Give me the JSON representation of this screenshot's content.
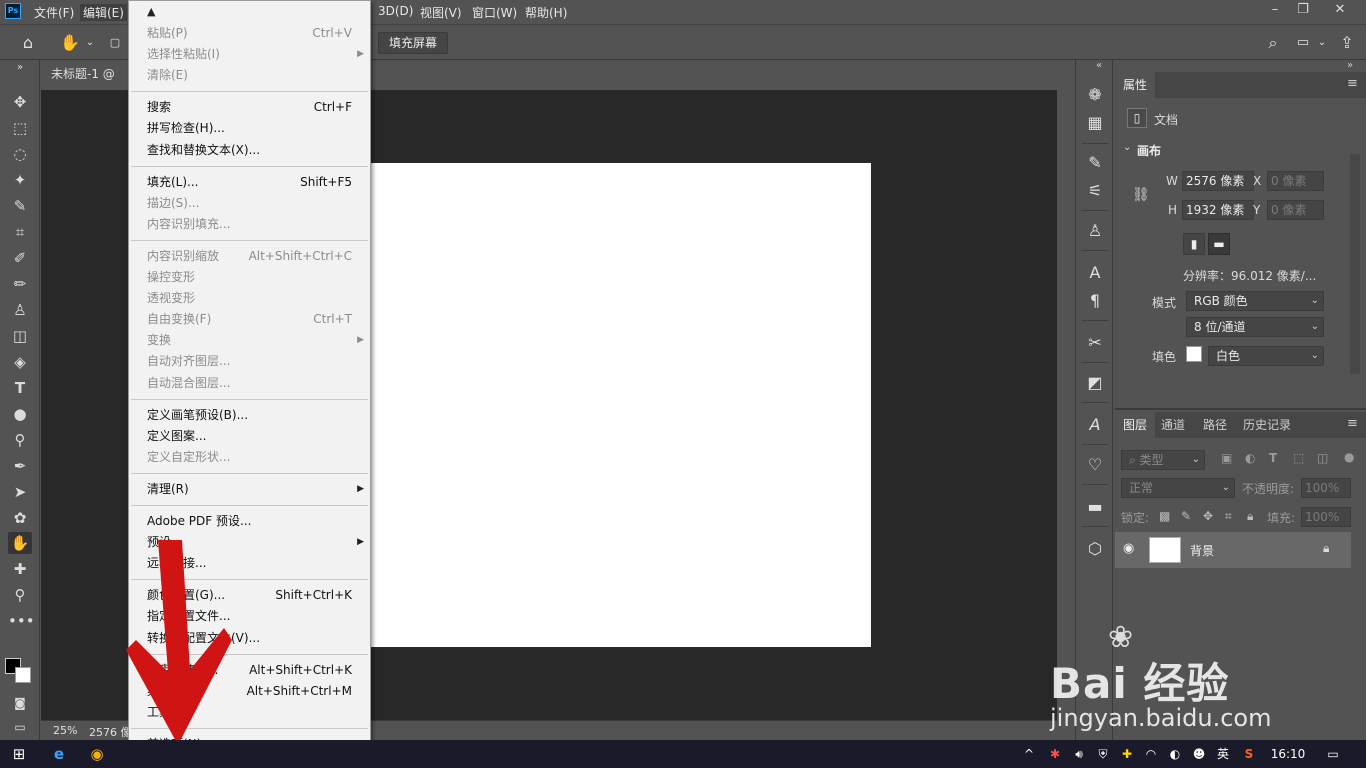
{
  "menubar": {
    "logo": "Ps",
    "items": [
      "文件(F)",
      "编辑(E)",
      "3D(D)",
      "视图(V)",
      "窗口(W)",
      "帮助(H)"
    ],
    "window_controls": [
      "–",
      "❐",
      "✕"
    ]
  },
  "options_bar": {
    "fill_screen": "填充屏幕"
  },
  "document": {
    "tab_title": "未标题-1 @ 25",
    "zoom": "25%",
    "doc_size": "2576 像"
  },
  "edit_menu": {
    "top_arrow": "▲",
    "bottom_arrow": "▼",
    "groups": [
      [
        {
          "label": "粘贴(P)",
          "shortcut": "Ctrl+V",
          "disabled": true,
          "submenu": false
        },
        {
          "label": "选择性粘贴(I)",
          "shortcut": "",
          "disabled": true,
          "submenu": true
        },
        {
          "label": "清除(E)",
          "shortcut": "",
          "disabled": true,
          "submenu": false
        }
      ],
      [
        {
          "label": "搜索",
          "shortcut": "Ctrl+F",
          "disabled": false,
          "submenu": false
        },
        {
          "label": "拼写检查(H)...",
          "shortcut": "",
          "disabled": false,
          "submenu": false
        },
        {
          "label": "查找和替换文本(X)...",
          "shortcut": "",
          "disabled": false,
          "submenu": false
        }
      ],
      [
        {
          "label": "填充(L)...",
          "shortcut": "Shift+F5",
          "disabled": false,
          "submenu": false
        },
        {
          "label": "描边(S)...",
          "shortcut": "",
          "disabled": true,
          "submenu": false
        },
        {
          "label": "内容识别填充...",
          "shortcut": "",
          "disabled": true,
          "submenu": false
        }
      ],
      [
        {
          "label": "内容识别缩放",
          "shortcut": "Alt+Shift+Ctrl+C",
          "disabled": true,
          "submenu": false
        },
        {
          "label": "操控变形",
          "shortcut": "",
          "disabled": true,
          "submenu": false
        },
        {
          "label": "透视变形",
          "shortcut": "",
          "disabled": true,
          "submenu": false
        },
        {
          "label": "自由变换(F)",
          "shortcut": "Ctrl+T",
          "disabled": true,
          "submenu": false
        },
        {
          "label": "变换",
          "shortcut": "",
          "disabled": true,
          "submenu": true
        },
        {
          "label": "自动对齐图层...",
          "shortcut": "",
          "disabled": true,
          "submenu": false
        },
        {
          "label": "自动混合图层...",
          "shortcut": "",
          "disabled": true,
          "submenu": false
        }
      ],
      [
        {
          "label": "定义画笔预设(B)...",
          "shortcut": "",
          "disabled": false,
          "submenu": false
        },
        {
          "label": "定义图案...",
          "shortcut": "",
          "disabled": false,
          "submenu": false
        },
        {
          "label": "定义自定形状...",
          "shortcut": "",
          "disabled": true,
          "submenu": false
        }
      ],
      [
        {
          "label": "清理(R)",
          "shortcut": "",
          "disabled": false,
          "submenu": true
        }
      ],
      [
        {
          "label": "Adobe PDF 预设...",
          "shortcut": "",
          "disabled": false,
          "submenu": false
        },
        {
          "label": "预设",
          "shortcut": "",
          "disabled": false,
          "submenu": true
        },
        {
          "label": "远程连接...",
          "shortcut": "",
          "disabled": false,
          "submenu": false
        }
      ],
      [
        {
          "label": "颜色设置(G)...",
          "shortcut": "Shift+Ctrl+K",
          "disabled": false,
          "submenu": false
        },
        {
          "label": "指定配置文件...",
          "shortcut": "",
          "disabled": false,
          "submenu": false
        },
        {
          "label": "转换为配置文件(V)...",
          "shortcut": "",
          "disabled": false,
          "submenu": false
        }
      ],
      [
        {
          "label": "键盘快捷键...",
          "shortcut": "Alt+Shift+Ctrl+K",
          "disabled": false,
          "submenu": false
        },
        {
          "label": "菜单(U)...",
          "shortcut": "Alt+Shift+Ctrl+M",
          "disabled": false,
          "submenu": false
        },
        {
          "label": "工具栏...",
          "shortcut": "",
          "disabled": false,
          "submenu": false
        }
      ],
      [
        {
          "label": "首选项(N)",
          "shortcut": "",
          "disabled": false,
          "submenu": true
        }
      ]
    ]
  },
  "properties_panel": {
    "tab": "属性",
    "doc_label": "文档",
    "canvas_section": "画布",
    "w_label": "W",
    "w_value": "2576 像素",
    "h_label": "H",
    "h_value": "1932 像素",
    "x_label": "X",
    "x_placeholder": "0 像素",
    "y_label": "Y",
    "y_placeholder": "0 像素",
    "resolution": "分辨率：96.012 像素/...",
    "mode_label": "模式",
    "mode_value": "RGB 颜色",
    "depth_value": "8 位/通道",
    "fill_label": "填色",
    "fill_value": "白色"
  },
  "layers_panel": {
    "tabs": [
      "图层",
      "通道",
      "路径",
      "历史记录"
    ],
    "filter_label": "类型",
    "blend_mode": "正常",
    "opacity_label": "不透明度:",
    "opacity_value": "100%",
    "lock_label": "锁定:",
    "fill_label": "填充:",
    "fill_value": "100%",
    "layer_name": "背景"
  },
  "taskbar": {
    "lang": "英",
    "time": "16:10"
  },
  "watermark": {
    "brand": "Bai  经验",
    "url": "jingyan.baidu.com"
  },
  "colors": {
    "accent_red": "#cc1010",
    "ui_dark": "#535353",
    "canvas_bg": "#282828"
  }
}
